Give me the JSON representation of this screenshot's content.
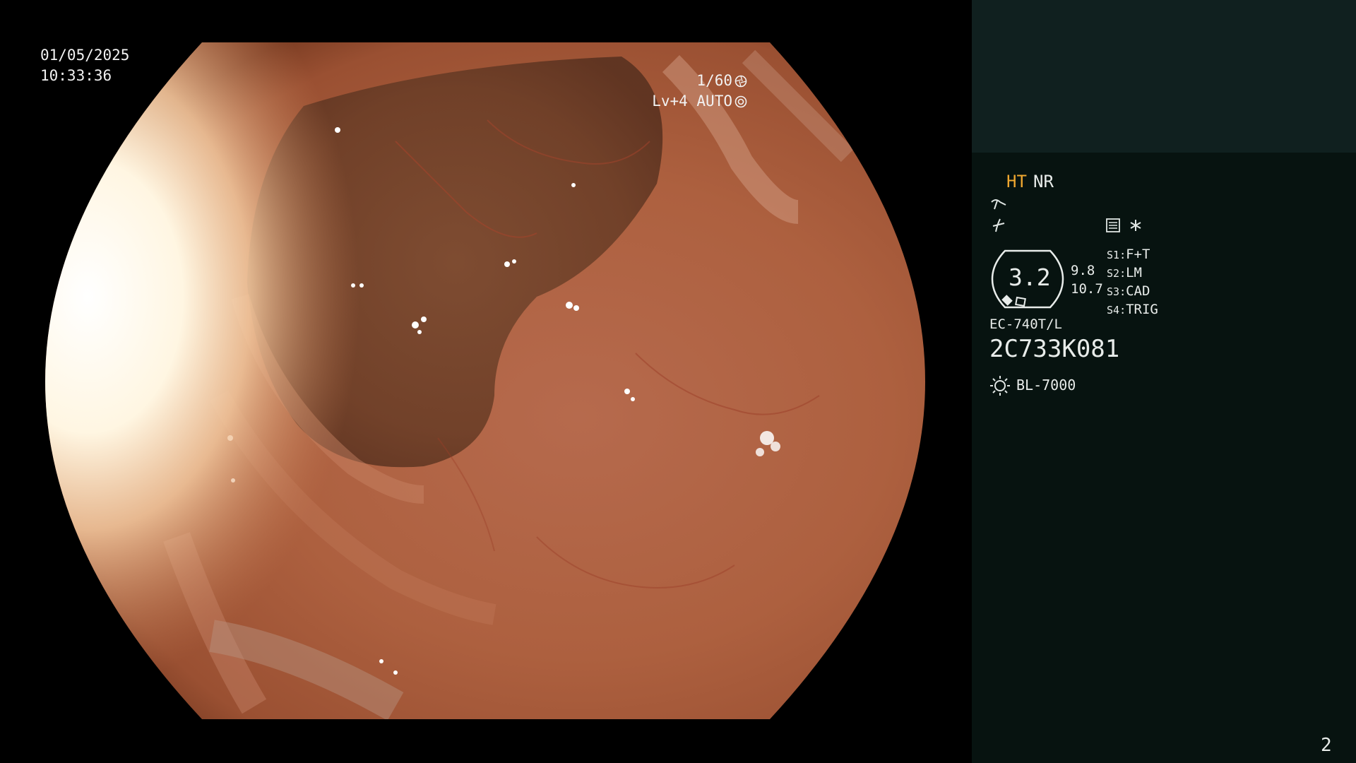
{
  "overlay": {
    "date": "01/05/2025",
    "time": "10:33:36",
    "shutter": "1/60",
    "exposure": "Lv+4 AUTO",
    "icons": [
      "aperture-icon",
      "iris-auto-icon"
    ]
  },
  "panel": {
    "mode_ht": "HT",
    "mode_nr": "NR",
    "zoom_value": "3.2",
    "near_value_1": "9.8",
    "near_value_2": "10.7",
    "slots": [
      {
        "key": "S1",
        "value": "F+T"
      },
      {
        "key": "S2",
        "value": "LM"
      },
      {
        "key": "S3",
        "value": "CAD"
      },
      {
        "key": "S4",
        "value": "TRIG"
      }
    ],
    "scope_model": "EC-740T/L",
    "scope_serial": "2C733K081",
    "light_source": "BL-7000",
    "page_number": "2",
    "icons": [
      "structure-enhance-icon",
      "color-mode-icon",
      "record-icon",
      "asterisk-icon",
      "zoom-ring-icon",
      "light-source-icon",
      "reference-thumbnail"
    ]
  },
  "colors": {
    "panel_bg": "#071310",
    "panel_top_bg": "#10201f",
    "ht_accent": "#f0a830",
    "tissue": "#b8694a"
  }
}
